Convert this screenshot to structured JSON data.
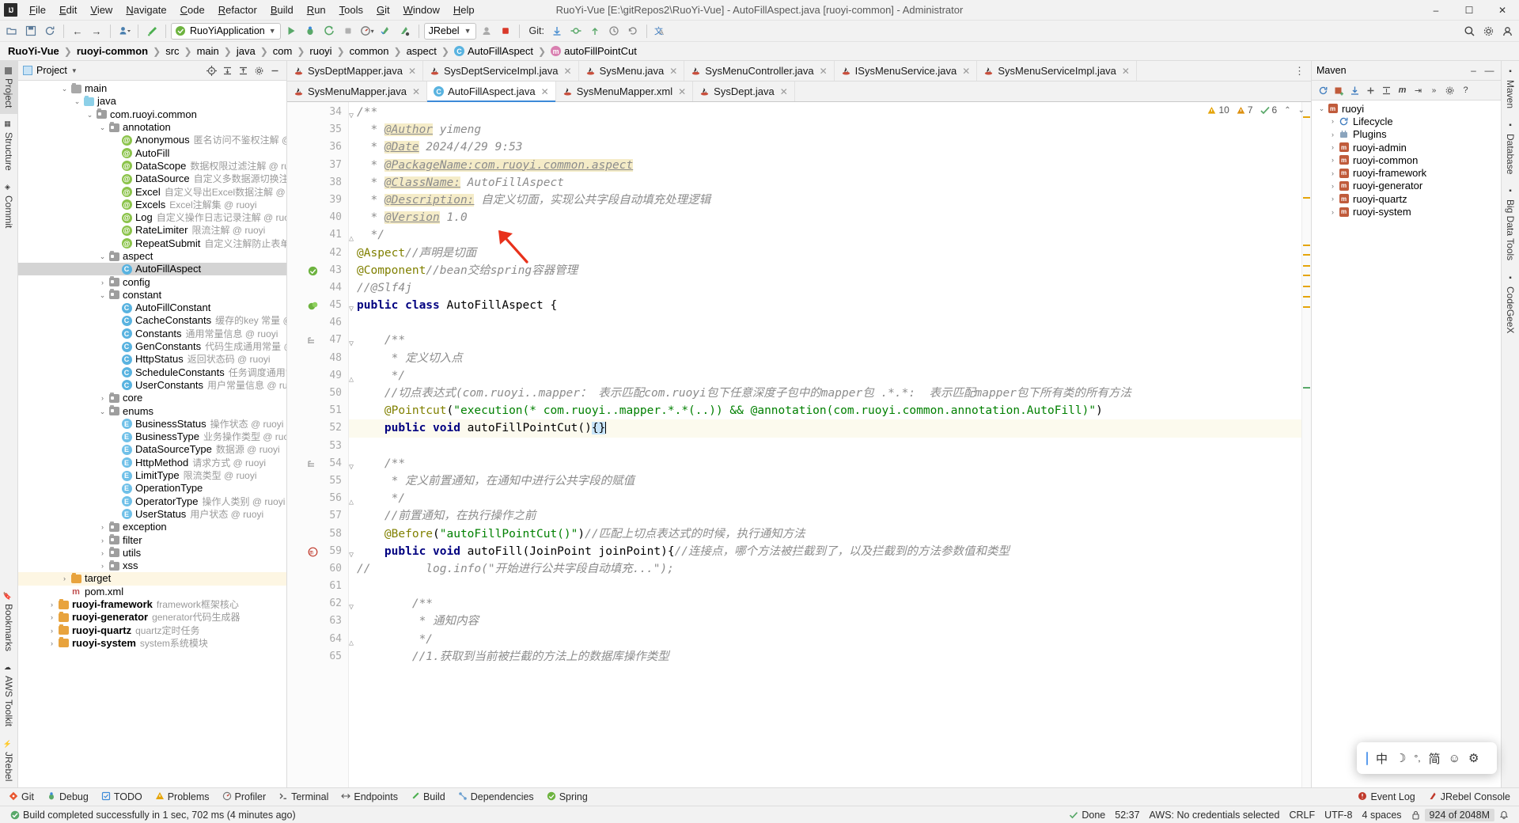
{
  "window": {
    "title": "RuoYi-Vue [E:\\gitRepos2\\RuoYi-Vue] - AutoFillAspect.java [ruoyi-common] - Administrator",
    "logo": "IJ",
    "minimize": "–",
    "maximize": "☐",
    "close": "✕"
  },
  "menu": [
    "File",
    "Edit",
    "View",
    "Navigate",
    "Code",
    "Refactor",
    "Build",
    "Run",
    "Tools",
    "Git",
    "Window",
    "Help"
  ],
  "toolbar": {
    "run_config": "RuoYiApplication",
    "jrebel": "JRebel",
    "git_label": "Git:",
    "icons": [
      "open-folder-icon",
      "save-all-icon",
      "sync-icon",
      "back-arrow-icon",
      "forward-arrow-icon",
      "profile-icon",
      "build-hammer-icon"
    ],
    "run_icons": [
      "run-icon",
      "debug-icon",
      "run-coverage-icon",
      "stop-icon",
      "profiler-icon",
      "jrebel-run-icon",
      "jrebel-debug-icon"
    ],
    "git_icons": [
      "update-project-icon",
      "commit-icon",
      "push-icon",
      "history-icon",
      "rollback-icon"
    ],
    "right_icons": [
      "search-everywhere-icon",
      "settings-gear-icon",
      "account-icon"
    ]
  },
  "breadcrumb": [
    {
      "label": "RuoYi-Vue",
      "bold": true,
      "icon": ""
    },
    {
      "label": "ruoyi-common",
      "bold": true,
      "icon": ""
    },
    {
      "label": "src",
      "bold": false,
      "icon": ""
    },
    {
      "label": "main",
      "bold": false,
      "icon": ""
    },
    {
      "label": "java",
      "bold": false,
      "icon": ""
    },
    {
      "label": "com",
      "bold": false,
      "icon": ""
    },
    {
      "label": "ruoyi",
      "bold": false,
      "icon": ""
    },
    {
      "label": "common",
      "bold": false,
      "icon": ""
    },
    {
      "label": "aspect",
      "bold": false,
      "icon": ""
    },
    {
      "label": "AutoFillAspect",
      "bold": false,
      "icon": "class-icon"
    },
    {
      "label": "autoFillPointCut",
      "bold": false,
      "icon": "method-icon"
    }
  ],
  "left_rail": {
    "top": [
      {
        "label": "Project",
        "icon": "project-icon",
        "active": true
      },
      {
        "label": "Structure",
        "icon": "structure-icon",
        "active": false
      },
      {
        "label": "Commit",
        "icon": "commit-icon",
        "active": false
      }
    ],
    "bottom": [
      {
        "label": "Bookmarks",
        "icon": "bookmarks-icon"
      },
      {
        "label": "AWS Toolkit",
        "icon": "aws-icon"
      },
      {
        "label": "JRebel",
        "icon": "jrebel-icon"
      }
    ]
  },
  "project_panel": {
    "title": "Project",
    "header_icons": [
      "locate-icon",
      "expand-all-icon",
      "collapse-all-icon",
      "settings-icon",
      "hide-icon"
    ],
    "tree": [
      {
        "indent": 3,
        "arrow": "v",
        "icon": "folder",
        "name": "main",
        "cmt": ""
      },
      {
        "indent": 4,
        "arrow": "v",
        "icon": "folder-blue",
        "name": "java",
        "cmt": ""
      },
      {
        "indent": 5,
        "arrow": "v",
        "icon": "folder-pkg",
        "name": "com.ruoyi.common",
        "cmt": ""
      },
      {
        "indent": 6,
        "arrow": "v",
        "icon": "folder-pkg",
        "name": "annotation",
        "cmt": ""
      },
      {
        "indent": 7,
        "arrow": "",
        "icon": "annotation",
        "name": "Anonymous",
        "cmt": "匿名访问不鉴权注解 @ ruoyi"
      },
      {
        "indent": 7,
        "arrow": "",
        "icon": "annotation",
        "name": "AutoFill",
        "cmt": ""
      },
      {
        "indent": 7,
        "arrow": "",
        "icon": "annotation",
        "name": "DataScope",
        "cmt": "数据权限过滤注解 @ ruoyi"
      },
      {
        "indent": 7,
        "arrow": "",
        "icon": "annotation",
        "name": "DataSource",
        "cmt": "自定义多数据源切换注解 @ ruoyi"
      },
      {
        "indent": 7,
        "arrow": "",
        "icon": "annotation",
        "name": "Excel",
        "cmt": "自定义导出Excel数据注解 @ ruoyi"
      },
      {
        "indent": 7,
        "arrow": "",
        "icon": "annotation",
        "name": "Excels",
        "cmt": "Excel注解集 @ ruoyi"
      },
      {
        "indent": 7,
        "arrow": "",
        "icon": "annotation",
        "name": "Log",
        "cmt": "自定义操作日志记录注解 @ ruoyi"
      },
      {
        "indent": 7,
        "arrow": "",
        "icon": "annotation",
        "name": "RateLimiter",
        "cmt": "限流注解 @ ruoyi"
      },
      {
        "indent": 7,
        "arrow": "",
        "icon": "annotation",
        "name": "RepeatSubmit",
        "cmt": "自定义注解防止表单重复提交 @"
      },
      {
        "indent": 6,
        "arrow": "v",
        "icon": "folder-pkg",
        "name": "aspect",
        "cmt": ""
      },
      {
        "indent": 7,
        "arrow": "",
        "icon": "class",
        "name": "AutoFillAspect",
        "cmt": "",
        "selected": true
      },
      {
        "indent": 6,
        "arrow": ">",
        "icon": "folder-pkg",
        "name": "config",
        "cmt": ""
      },
      {
        "indent": 6,
        "arrow": "v",
        "icon": "folder-pkg",
        "name": "constant",
        "cmt": ""
      },
      {
        "indent": 7,
        "arrow": "",
        "icon": "class",
        "name": "AutoFillConstant",
        "cmt": ""
      },
      {
        "indent": 7,
        "arrow": "",
        "icon": "class",
        "name": "CacheConstants",
        "cmt": "缓存的key 常量 @ ruoyi"
      },
      {
        "indent": 7,
        "arrow": "",
        "icon": "class",
        "name": "Constants",
        "cmt": "通用常量信息 @ ruoyi"
      },
      {
        "indent": 7,
        "arrow": "",
        "icon": "class",
        "name": "GenConstants",
        "cmt": "代码生成通用常量 @ ruoyi"
      },
      {
        "indent": 7,
        "arrow": "",
        "icon": "class",
        "name": "HttpStatus",
        "cmt": "返回状态码 @ ruoyi"
      },
      {
        "indent": 7,
        "arrow": "",
        "icon": "class",
        "name": "ScheduleConstants",
        "cmt": "任务调度通用常量 @ ruoy"
      },
      {
        "indent": 7,
        "arrow": "",
        "icon": "class",
        "name": "UserConstants",
        "cmt": "用户常量信息 @ ruoyi"
      },
      {
        "indent": 6,
        "arrow": ">",
        "icon": "folder-pkg",
        "name": "core",
        "cmt": ""
      },
      {
        "indent": 6,
        "arrow": "v",
        "icon": "folder-pkg",
        "name": "enums",
        "cmt": ""
      },
      {
        "indent": 7,
        "arrow": "",
        "icon": "enum",
        "name": "BusinessStatus",
        "cmt": "操作状态 @ ruoyi"
      },
      {
        "indent": 7,
        "arrow": "",
        "icon": "enum",
        "name": "BusinessType",
        "cmt": "业务操作类型 @ ruoyi"
      },
      {
        "indent": 7,
        "arrow": "",
        "icon": "enum",
        "name": "DataSourceType",
        "cmt": "数据源 @ ruoyi"
      },
      {
        "indent": 7,
        "arrow": "",
        "icon": "enum",
        "name": "HttpMethod",
        "cmt": "请求方式 @ ruoyi"
      },
      {
        "indent": 7,
        "arrow": "",
        "icon": "enum",
        "name": "LimitType",
        "cmt": "限流类型 @ ruoyi"
      },
      {
        "indent": 7,
        "arrow": "",
        "icon": "enum",
        "name": "OperationType",
        "cmt": ""
      },
      {
        "indent": 7,
        "arrow": "",
        "icon": "enum",
        "name": "OperatorType",
        "cmt": "操作人类别 @ ruoyi"
      },
      {
        "indent": 7,
        "arrow": "",
        "icon": "enum",
        "name": "UserStatus",
        "cmt": "用户状态 @ ruoyi"
      },
      {
        "indent": 6,
        "arrow": ">",
        "icon": "folder-pkg",
        "name": "exception",
        "cmt": ""
      },
      {
        "indent": 6,
        "arrow": ">",
        "icon": "folder-pkg",
        "name": "filter",
        "cmt": ""
      },
      {
        "indent": 6,
        "arrow": ">",
        "icon": "folder-pkg",
        "name": "utils",
        "cmt": ""
      },
      {
        "indent": 6,
        "arrow": ">",
        "icon": "folder-pkg",
        "name": "xss",
        "cmt": ""
      },
      {
        "indent": 3,
        "arrow": ">",
        "icon": "folder-orange",
        "name": "target",
        "cmt": "",
        "highlight": true
      },
      {
        "indent": 3,
        "arrow": "",
        "icon": "xml",
        "name": "pom.xml",
        "cmt": ""
      },
      {
        "indent": 2,
        "arrow": ">",
        "icon": "folder-module",
        "name": "ruoyi-framework",
        "cmt": "framework框架核心",
        "bold": true
      },
      {
        "indent": 2,
        "arrow": ">",
        "icon": "folder-module",
        "name": "ruoyi-generator",
        "cmt": "generator代码生成器",
        "bold": true
      },
      {
        "indent": 2,
        "arrow": ">",
        "icon": "folder-module",
        "name": "ruoyi-quartz",
        "cmt": "quartz定时任务",
        "bold": true
      },
      {
        "indent": 2,
        "arrow": ">",
        "icon": "folder-module",
        "name": "ruoyi-system",
        "cmt": "system系统模块",
        "bold": true
      }
    ]
  },
  "editor_tabs_row1": [
    {
      "label": "SysDeptMapper.java",
      "icon": "java-file-icon",
      "active": false
    },
    {
      "label": "SysDeptServiceImpl.java",
      "icon": "java-file-icon",
      "active": false
    },
    {
      "label": "SysMenu.java",
      "icon": "java-file-icon",
      "active": false
    },
    {
      "label": "SysMenuController.java",
      "icon": "java-file-icon",
      "active": false
    },
    {
      "label": "ISysMenuService.java",
      "icon": "java-file-icon",
      "active": false
    },
    {
      "label": "SysMenuServiceImpl.java",
      "icon": "java-file-icon",
      "active": false
    }
  ],
  "editor_tabs_row2": [
    {
      "label": "SysMenuMapper.java",
      "icon": "java-file-icon",
      "active": false
    },
    {
      "label": "AutoFillAspect.java",
      "icon": "class-icon",
      "active": true
    },
    {
      "label": "SysMenuMapper.xml",
      "icon": "xml-file-icon",
      "active": false
    },
    {
      "label": "SysDept.java",
      "icon": "java-file-icon",
      "active": false
    }
  ],
  "inspection": {
    "warnings_count": "10",
    "errors_count": "7",
    "checks_count": "6",
    "warn_icon": "warning-triangle-icon",
    "error_icon": "error-triangle-icon",
    "ok_icon": "checkmark-icon",
    "up_icon": "chevron-up-icon",
    "down_icon": "chevron-down-icon"
  },
  "code": {
    "first_line_number": 34,
    "lines": [
      {
        "n": 34,
        "gutter": "",
        "fold": "v",
        "html": "<span class=\"jd\">/**</span>"
      },
      {
        "n": 35,
        "gutter": "",
        "fold": "",
        "html": "<span class=\"jd\">  * </span><span class=\"jdtag\">@Author</span><span class=\"jd\"> yimeng</span>"
      },
      {
        "n": 36,
        "gutter": "",
        "fold": "",
        "html": "<span class=\"jd\">  * </span><span class=\"jdtag\">@Date</span><span class=\"jd\"> 2024/4/29 9:53</span>"
      },
      {
        "n": 37,
        "gutter": "",
        "fold": "",
        "html": "<span class=\"jd\">  * </span><span class=\"jdtag\">@PackageName:com.ruoyi.common.aspect</span>"
      },
      {
        "n": 38,
        "gutter": "",
        "fold": "",
        "html": "<span class=\"jd\">  * </span><span class=\"jdtag\">@ClassName:</span><span class=\"jd\"> AutoFillAspect</span>"
      },
      {
        "n": 39,
        "gutter": "",
        "fold": "",
        "html": "<span class=\"jd\">  * </span><span class=\"jdtag\">@Description:</span><span class=\"jd\"> 自定义切面，实现公共字段自动填充处理逻辑</span>"
      },
      {
        "n": 40,
        "gutter": "",
        "fold": "",
        "html": "<span class=\"jd\">  * </span><span class=\"jdtag\">@Version</span><span class=\"jd\"> 1.0</span>"
      },
      {
        "n": 41,
        "gutter": "",
        "fold": "^",
        "html": "<span class=\"jd\">  */</span>"
      },
      {
        "n": 42,
        "gutter": "",
        "fold": "",
        "html": "<span class=\"ann\">@Aspect</span><span class=\"cm\">//声明是切面</span>"
      },
      {
        "n": 43,
        "gutter": "spring",
        "fold": "",
        "html": "<span class=\"ann\">@Component</span><span class=\"cm\">//bean交给spring容器管理</span>"
      },
      {
        "n": 44,
        "gutter": "",
        "fold": "",
        "html": "<span class=\"cm\">//@Slf4j</span>"
      },
      {
        "n": 45,
        "gutter": "beans",
        "fold": "v",
        "html": "<span class=\"kw\">public class</span> AutoFillAspect {"
      },
      {
        "n": 46,
        "gutter": "",
        "fold": "",
        "html": ""
      },
      {
        "n": 47,
        "gutter": "doc",
        "fold": "v",
        "html": "    <span class=\"jd\">/**</span>"
      },
      {
        "n": 48,
        "gutter": "",
        "fold": "",
        "html": "     <span class=\"jd\">* 定义切入点</span>"
      },
      {
        "n": 49,
        "gutter": "",
        "fold": "^",
        "html": "     <span class=\"jd\">*/</span>"
      },
      {
        "n": 50,
        "gutter": "",
        "fold": "",
        "html": "    <span class=\"cm\">//切点表达式(com.ruoyi..mapper： 表示匹配com.ruoyi包下任意深度子包中的mapper包 .*.*:  表示匹配mapper包下所有类的所有方法</span>"
      },
      {
        "n": 51,
        "gutter": "",
        "fold": "",
        "html": "    <span class=\"ann\">@Pointcut</span>(<span class=\"str\">\"execution(* com.ruoyi..mapper.*.*(..)) &amp;&amp; @annotation(com.ruoyi.common.annotation.AutoFill)\"</span>)"
      },
      {
        "n": 52,
        "gutter": "",
        "fold": "",
        "hl": true,
        "html": "    <span class=\"kw\">public void</span> autoFillPointCut()<span class=\"sel-brace\">{}</span><span class=\"caret\"></span>"
      },
      {
        "n": 53,
        "gutter": "",
        "fold": "",
        "html": ""
      },
      {
        "n": 54,
        "gutter": "doc",
        "fold": "v",
        "html": "    <span class=\"jd\">/**</span>"
      },
      {
        "n": 55,
        "gutter": "",
        "fold": "",
        "html": "     <span class=\"jd\">* 定义前置通知，在通知中进行公共字段的赋值</span>"
      },
      {
        "n": 56,
        "gutter": "",
        "fold": "^",
        "html": "     <span class=\"jd\">*/</span>"
      },
      {
        "n": 57,
        "gutter": "",
        "fold": "",
        "html": "    <span class=\"cm\">//前置通知，在执行操作之前</span>"
      },
      {
        "n": 58,
        "gutter": "",
        "fold": "",
        "html": "    <span class=\"ann\">@Before</span>(<span class=\"str\">\"autoFillPointCut()\"</span>)<span class=\"cm\">//匹配上切点表达式的时候，执行通知方法</span>"
      },
      {
        "n": 59,
        "gutter": "aspect",
        "fold": "v",
        "html": "    <span class=\"kw\">public void</span> autoFill(JoinPoint joinPoint){<span class=\"cm\">//连接点，哪个方法被拦截到了，以及拦截到的方法参数值和类型</span>"
      },
      {
        "n": 60,
        "gutter": "",
        "fold": "",
        "html": "<span class=\"cm\">//        log.info(\"开始进行公共字段自动填充...\");</span>"
      },
      {
        "n": 61,
        "gutter": "",
        "fold": "",
        "html": ""
      },
      {
        "n": 62,
        "gutter": "",
        "fold": "v",
        "html": "        <span class=\"jd\">/**</span>"
      },
      {
        "n": 63,
        "gutter": "",
        "fold": "",
        "html": "         <span class=\"jd\">* 通知内容</span>"
      },
      {
        "n": 64,
        "gutter": "",
        "fold": "^",
        "html": "         <span class=\"jd\">*/</span>"
      },
      {
        "n": 65,
        "gutter": "",
        "fold": "",
        "html": "        <span class=\"cm\">//1.获取到当前被拦截的方法上的数据库操作类型</span>"
      }
    ]
  },
  "maven": {
    "title": "Maven",
    "toolbar_icons": [
      "refresh-icon",
      "add-maven-icon",
      "download-sources-icon",
      "plus-icon",
      "collapse-icon",
      "run-maven-icon",
      "skip-tests-icon",
      "execute-goal-icon",
      "settings-icon",
      "help-icon"
    ],
    "minimize": "–",
    "hide": "—",
    "tree": [
      {
        "indent": 0,
        "arrow": "v",
        "icon": "maven-m",
        "name": "ruoyi"
      },
      {
        "indent": 1,
        "arrow": ">",
        "icon": "lifecycle",
        "name": "Lifecycle"
      },
      {
        "indent": 1,
        "arrow": ">",
        "icon": "plugins",
        "name": "Plugins"
      },
      {
        "indent": 1,
        "arrow": ">",
        "icon": "maven-m",
        "name": "ruoyi-admin"
      },
      {
        "indent": 1,
        "arrow": ">",
        "icon": "maven-m",
        "name": "ruoyi-common"
      },
      {
        "indent": 1,
        "arrow": ">",
        "icon": "maven-m",
        "name": "ruoyi-framework"
      },
      {
        "indent": 1,
        "arrow": ">",
        "icon": "maven-m",
        "name": "ruoyi-generator"
      },
      {
        "indent": 1,
        "arrow": ">",
        "icon": "maven-m",
        "name": "ruoyi-quartz"
      },
      {
        "indent": 1,
        "arrow": ">",
        "icon": "maven-m",
        "name": "ruoyi-system"
      }
    ]
  },
  "right_rail": [
    {
      "label": "Maven",
      "icon": "maven-icon"
    },
    {
      "label": "Database",
      "icon": "database-icon"
    },
    {
      "label": "Big Data Tools",
      "icon": "bigdata-icon"
    },
    {
      "label": "CodeGeeX",
      "icon": "codegeex-icon"
    }
  ],
  "tool_window_bar": {
    "left": [
      {
        "label": "Git",
        "icon": "git-icon"
      },
      {
        "label": "Debug",
        "icon": "debug-icon"
      },
      {
        "label": "TODO",
        "icon": "todo-icon"
      },
      {
        "label": "Problems",
        "icon": "problems-icon"
      },
      {
        "label": "Profiler",
        "icon": "profiler-icon"
      },
      {
        "label": "Terminal",
        "icon": "terminal-icon"
      },
      {
        "label": "Endpoints",
        "icon": "endpoints-icon"
      },
      {
        "label": "Build",
        "icon": "build-icon"
      },
      {
        "label": "Dependencies",
        "icon": "dependencies-icon"
      },
      {
        "label": "Spring",
        "icon": "spring-icon"
      }
    ],
    "right": [
      {
        "label": "Event Log",
        "icon": "event-log-icon"
      },
      {
        "label": "JRebel Console",
        "icon": "jrebel-console-icon"
      }
    ]
  },
  "statusbar": {
    "build_icon": "checkmark-icon",
    "message": "Build completed successfully in 1 sec, 702 ms (4 minutes ago)",
    "done": "Done",
    "caret": "52:37",
    "aws": "AWS: No credentials selected",
    "line_sep": "CRLF",
    "encoding": "UTF-8",
    "indent": "4 spaces",
    "memory": "924 of 2048M",
    "lock_icon": "lock-icon",
    "notifications_icon": "bell-icon"
  },
  "ime_popup": {
    "lang": "中",
    "mode_icon": "moon-icon",
    "punct_icon": "punctuation-icon",
    "simplified": "简",
    "emoji_icon": "emoji-icon",
    "settings_icon": "gear-icon"
  },
  "colors": {
    "accent": "#3d8ad8",
    "selection": "#d4d4d4",
    "highlight_line": "#fcfaee",
    "annotation": "#808000",
    "keyword": "#000080",
    "string": "#008000",
    "comment": "#8c8c8c",
    "javadoc_tag_bg": "#f5ecc8",
    "arrow_red": "#e03020",
    "green": "#59a869"
  }
}
